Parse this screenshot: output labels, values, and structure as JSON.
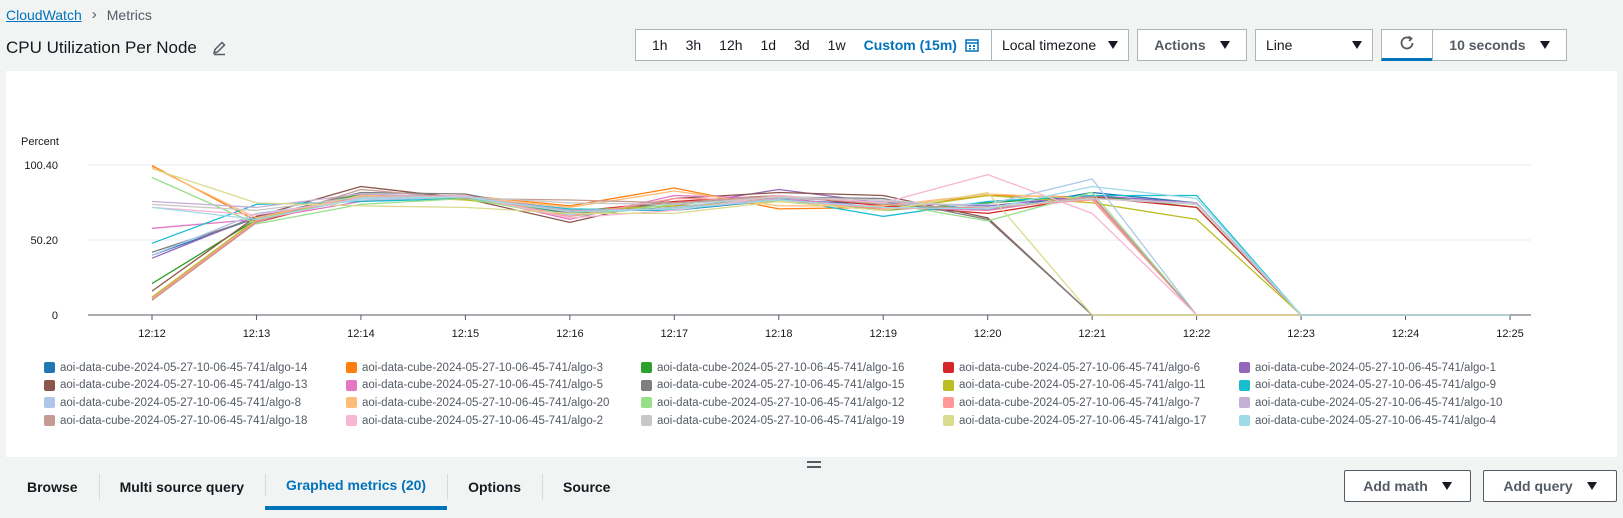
{
  "breadcrumb": {
    "root": "CloudWatch",
    "current": "Metrics"
  },
  "title": "CPU Utilization Per Node",
  "toolbar": {
    "ranges": [
      "1h",
      "3h",
      "12h",
      "1d",
      "3d",
      "1w"
    ],
    "custom_range": "Custom (15m)",
    "timezone": "Local timezone",
    "actions": "Actions",
    "graph_type": "Line",
    "interval": "10 seconds"
  },
  "icons": {
    "edit": "pencil-icon",
    "calendar": "calendar-icon",
    "refresh": "refresh-icon",
    "caret": "caret-down-icon",
    "drag": "drag-handle-icon"
  },
  "tabs": [
    {
      "label": "Browse",
      "active": false
    },
    {
      "label": "Multi source query",
      "active": false
    },
    {
      "label": "Graphed metrics (20)",
      "active": true
    },
    {
      "label": "Options",
      "active": false
    },
    {
      "label": "Source",
      "active": false
    }
  ],
  "bottom_buttons": {
    "add_math": "Add math",
    "add_query": "Add query"
  },
  "chart_data": {
    "type": "line",
    "ylabel": "Percent",
    "yticks": [
      0,
      50.2,
      100.4
    ],
    "ytick_labels": [
      "0",
      "50.20",
      "100.40"
    ],
    "ylim": [
      0,
      100.4
    ],
    "x": [
      "12:12",
      "12:13",
      "12:14",
      "12:15",
      "12:16",
      "12:17",
      "12:18",
      "12:19",
      "12:20",
      "12:21",
      "12:22",
      "12:23",
      "12:24",
      "12:25"
    ],
    "grid": true,
    "legend": "bottom",
    "series": [
      {
        "name": "aoi-data-cube-2024-05-27-10-06-45-741/algo-14",
        "color": "#1f77b4",
        "values": [
          40,
          65,
          80,
          79,
          70,
          70,
          77,
          74,
          70,
          82,
          75,
          0,
          0,
          0
        ]
      },
      {
        "name": "aoi-data-cube-2024-05-27-10-06-45-741/algo-3",
        "color": "#ff7f0e",
        "values": [
          100,
          63,
          79,
          80,
          73,
          85,
          71,
          72,
          80,
          79,
          0,
          0,
          0,
          0
        ]
      },
      {
        "name": "aoi-data-cube-2024-05-27-10-06-45-741/algo-16",
        "color": "#2ca02c",
        "values": [
          21,
          64,
          81,
          78,
          68,
          72,
          79,
          70,
          75,
          80,
          72,
          0,
          0,
          0
        ]
      },
      {
        "name": "aoi-data-cube-2024-05-27-10-06-45-741/algo-6",
        "color": "#d62728",
        "values": [
          10,
          62,
          80,
          79,
          69,
          76,
          80,
          73,
          68,
          79,
          72,
          0,
          0,
          0
        ]
      },
      {
        "name": "aoi-data-cube-2024-05-27-10-06-45-741/algo-1",
        "color": "#9467bd",
        "values": [
          38,
          66,
          79,
          80,
          70,
          73,
          84,
          75,
          73,
          80,
          75,
          0,
          0,
          0
        ]
      },
      {
        "name": "aoi-data-cube-2024-05-27-10-06-45-741/algo-13",
        "color": "#8c564b",
        "values": [
          16,
          66,
          86,
          78,
          62,
          78,
          82,
          80,
          65,
          0,
          0,
          0,
          0,
          0
        ]
      },
      {
        "name": "aoi-data-cube-2024-05-27-10-06-45-741/algo-5",
        "color": "#e377c2",
        "values": [
          58,
          64,
          76,
          80,
          64,
          80,
          78,
          72,
          70,
          80,
          0,
          0,
          0,
          0
        ]
      },
      {
        "name": "aoi-data-cube-2024-05-27-10-06-45-741/algo-15",
        "color": "#7f7f7f",
        "values": [
          42,
          65,
          82,
          81,
          68,
          75,
          79,
          78,
          64,
          0,
          0,
          0,
          0,
          0
        ]
      },
      {
        "name": "aoi-data-cube-2024-05-27-10-06-45-741/algo-11",
        "color": "#bcbd22",
        "values": [
          12,
          64,
          80,
          77,
          70,
          73,
          76,
          70,
          80,
          75,
          64,
          0,
          0,
          0
        ]
      },
      {
        "name": "aoi-data-cube-2024-05-27-10-06-45-741/algo-9",
        "color": "#17becf",
        "values": [
          48,
          74,
          76,
          78,
          71,
          70,
          78,
          66,
          76,
          80,
          80,
          0,
          0,
          0
        ]
      },
      {
        "name": "aoi-data-cube-2024-05-27-10-06-45-741/algo-8",
        "color": "#aec7e8",
        "values": [
          40,
          68,
          77,
          79,
          67,
          72,
          80,
          74,
          74,
          91,
          0,
          0,
          0,
          0
        ]
      },
      {
        "name": "aoi-data-cube-2024-05-27-10-06-45-741/algo-20",
        "color": "#ffbb78",
        "values": [
          99,
          65,
          80,
          79,
          72,
          83,
          73,
          73,
          81,
          78,
          0,
          0,
          0,
          0
        ]
      },
      {
        "name": "aoi-data-cube-2024-05-27-10-06-45-741/algo-12",
        "color": "#98df8a",
        "values": [
          92,
          61,
          74,
          78,
          66,
          74,
          79,
          75,
          63,
          82,
          0,
          0,
          0,
          0
        ]
      },
      {
        "name": "aoi-data-cube-2024-05-27-10-06-45-741/algo-7",
        "color": "#ff9896",
        "values": [
          11,
          63,
          79,
          80,
          66,
          78,
          77,
          71,
          72,
          77,
          0,
          0,
          0,
          0
        ]
      },
      {
        "name": "aoi-data-cube-2024-05-27-10-06-45-741/algo-10",
        "color": "#c5b0d5",
        "values": [
          76,
          72,
          81,
          79,
          70,
          71,
          78,
          76,
          72,
          78,
          75,
          0,
          0,
          0
        ]
      },
      {
        "name": "aoi-data-cube-2024-05-27-10-06-45-741/algo-18",
        "color": "#c49c94",
        "values": [
          10,
          62,
          84,
          78,
          77,
          75,
          80,
          74,
          71,
          79,
          0,
          0,
          0,
          0
        ]
      },
      {
        "name": "aoi-data-cube-2024-05-27-10-06-45-741/algo-2",
        "color": "#f7b6d2",
        "values": [
          72,
          67,
          78,
          80,
          65,
          70,
          80,
          75,
          94,
          68,
          0,
          0,
          0,
          0
        ]
      },
      {
        "name": "aoi-data-cube-2024-05-27-10-06-45-741/algo-19",
        "color": "#c7c7c7",
        "values": [
          74,
          70,
          79,
          79,
          75,
          74,
          79,
          77,
          72,
          78,
          74,
          0,
          0,
          0
        ]
      },
      {
        "name": "aoi-data-cube-2024-05-27-10-06-45-741/algo-17",
        "color": "#dbdb8d",
        "values": [
          98,
          75,
          73,
          72,
          68,
          68,
          76,
          70,
          82,
          0,
          0,
          0,
          0,
          0
        ]
      },
      {
        "name": "aoi-data-cube-2024-05-27-10-06-45-741/algo-4",
        "color": "#9edae5",
        "values": [
          72,
          64,
          78,
          79,
          69,
          71,
          77,
          72,
          71,
          86,
          78,
          0,
          0,
          0
        ]
      }
    ]
  }
}
